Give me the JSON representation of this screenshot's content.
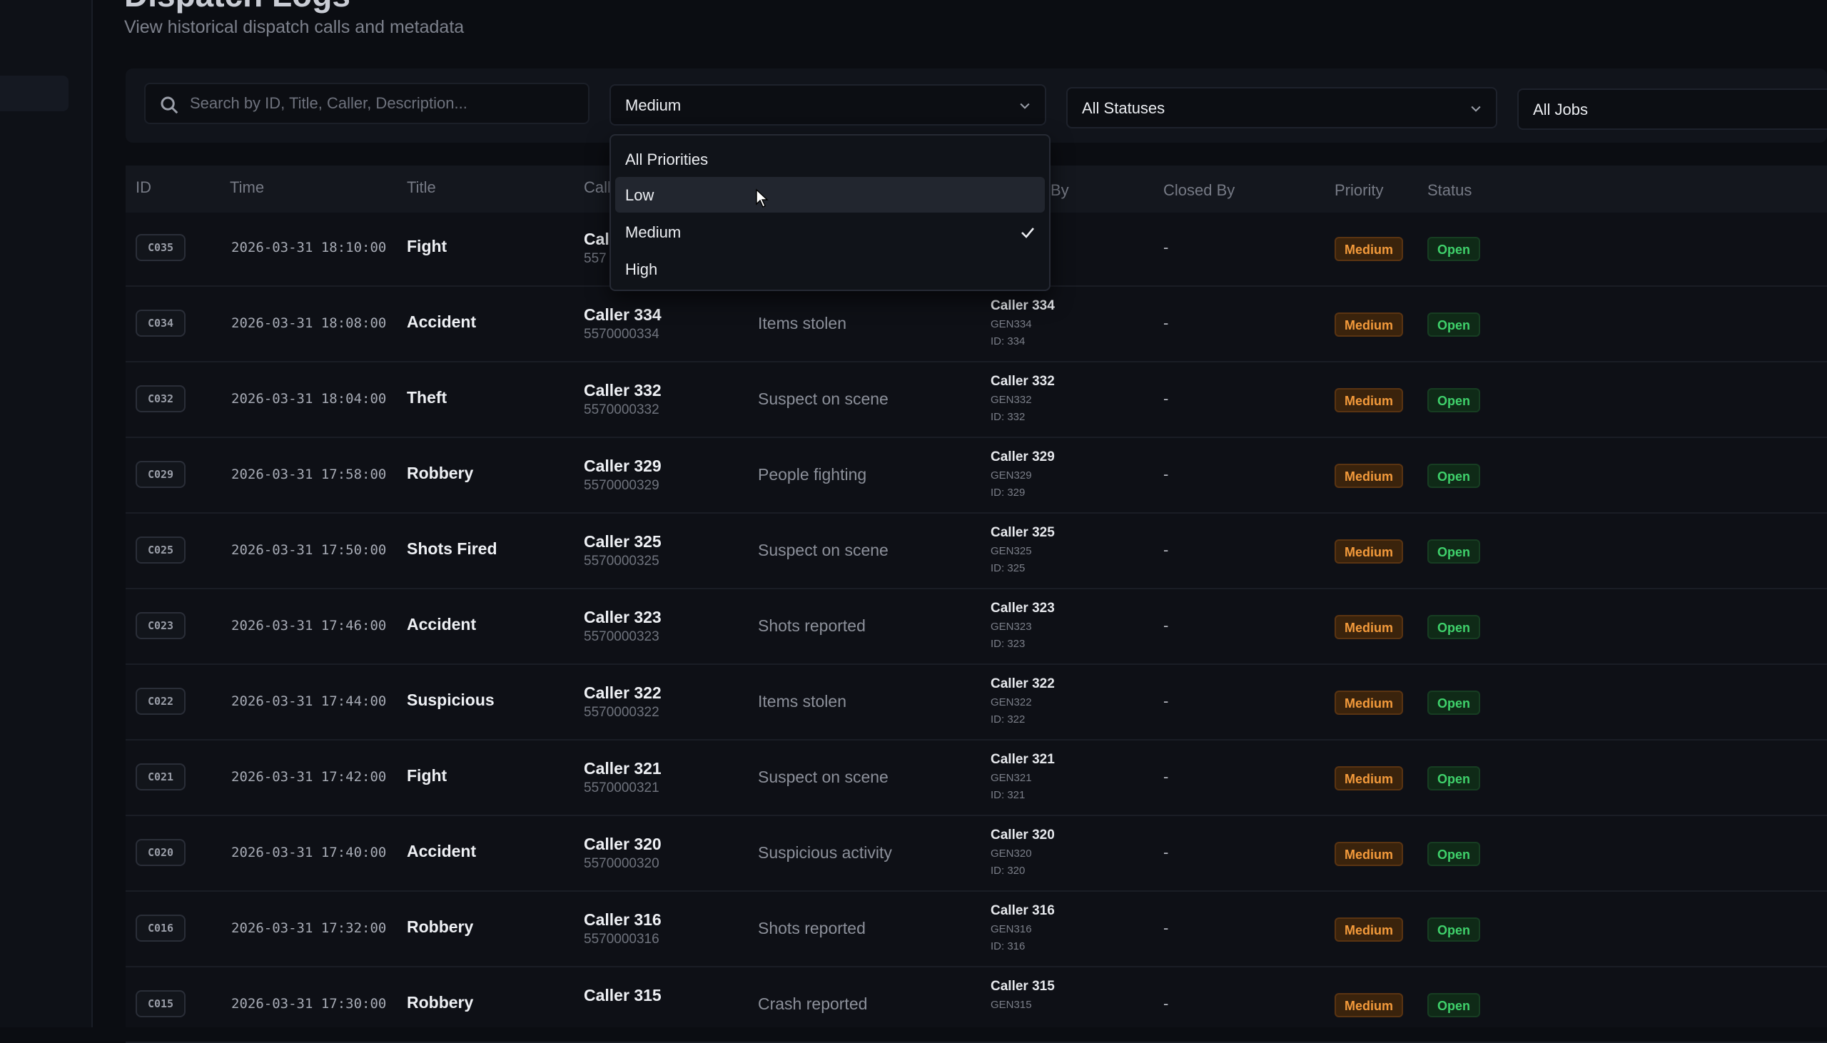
{
  "header": {
    "title": "Dispatch Logs",
    "subtitle": "View historical dispatch calls and metadata"
  },
  "filters": {
    "search_placeholder": "Search by ID, Title, Caller, Description...",
    "priority_value": "Medium",
    "status_value": "All Statuses",
    "jobs_value": "All Jobs"
  },
  "priority_dropdown": {
    "options": [
      "All Priorities",
      "Low",
      "Medium",
      "High"
    ],
    "selected": "Medium",
    "hovered": "Low"
  },
  "table": {
    "columns": {
      "id": "ID",
      "time": "Time",
      "title": "Title",
      "caller": "Call",
      "created_by": "By",
      "closed_by": "Closed By",
      "priority": "Priority",
      "status": "Status"
    },
    "rows": [
      {
        "id": "C035",
        "time": "2026-03-31 18:10:00",
        "title": "Fight",
        "caller": "Call",
        "phone": "557",
        "description": "",
        "cb_name": "",
        "cb_gen": "",
        "cb_id": "",
        "closed_by": "-",
        "priority": "Medium",
        "status": "Open"
      },
      {
        "id": "C034",
        "time": "2026-03-31 18:08:00",
        "title": "Accident",
        "caller": "Caller 334",
        "phone": "5570000334",
        "description": "Items stolen",
        "cb_name": "Caller 334",
        "cb_gen": "GEN334",
        "cb_id": "ID: 334",
        "closed_by": "-",
        "priority": "Medium",
        "status": "Open"
      },
      {
        "id": "C032",
        "time": "2026-03-31 18:04:00",
        "title": "Theft",
        "caller": "Caller 332",
        "phone": "5570000332",
        "description": "Suspect on scene",
        "cb_name": "Caller 332",
        "cb_gen": "GEN332",
        "cb_id": "ID: 332",
        "closed_by": "-",
        "priority": "Medium",
        "status": "Open"
      },
      {
        "id": "C029",
        "time": "2026-03-31 17:58:00",
        "title": "Robbery",
        "caller": "Caller 329",
        "phone": "5570000329",
        "description": "People fighting",
        "cb_name": "Caller 329",
        "cb_gen": "GEN329",
        "cb_id": "ID: 329",
        "closed_by": "-",
        "priority": "Medium",
        "status": "Open"
      },
      {
        "id": "C025",
        "time": "2026-03-31 17:50:00",
        "title": "Shots Fired",
        "caller": "Caller 325",
        "phone": "5570000325",
        "description": "Suspect on scene",
        "cb_name": "Caller 325",
        "cb_gen": "GEN325",
        "cb_id": "ID: 325",
        "closed_by": "-",
        "priority": "Medium",
        "status": "Open"
      },
      {
        "id": "C023",
        "time": "2026-03-31 17:46:00",
        "title": "Accident",
        "caller": "Caller 323",
        "phone": "5570000323",
        "description": "Shots reported",
        "cb_name": "Caller 323",
        "cb_gen": "GEN323",
        "cb_id": "ID: 323",
        "closed_by": "-",
        "priority": "Medium",
        "status": "Open"
      },
      {
        "id": "C022",
        "time": "2026-03-31 17:44:00",
        "title": "Suspicious",
        "caller": "Caller 322",
        "phone": "5570000322",
        "description": "Items stolen",
        "cb_name": "Caller 322",
        "cb_gen": "GEN322",
        "cb_id": "ID: 322",
        "closed_by": "-",
        "priority": "Medium",
        "status": "Open"
      },
      {
        "id": "C021",
        "time": "2026-03-31 17:42:00",
        "title": "Fight",
        "caller": "Caller 321",
        "phone": "5570000321",
        "description": "Suspect on scene",
        "cb_name": "Caller 321",
        "cb_gen": "GEN321",
        "cb_id": "ID: 321",
        "closed_by": "-",
        "priority": "Medium",
        "status": "Open"
      },
      {
        "id": "C020",
        "time": "2026-03-31 17:40:00",
        "title": "Accident",
        "caller": "Caller 320",
        "phone": "5570000320",
        "description": "Suspicious activity",
        "cb_name": "Caller 320",
        "cb_gen": "GEN320",
        "cb_id": "ID: 320",
        "closed_by": "-",
        "priority": "Medium",
        "status": "Open"
      },
      {
        "id": "C016",
        "time": "2026-03-31 17:32:00",
        "title": "Robbery",
        "caller": "Caller 316",
        "phone": "5570000316",
        "description": "Shots reported",
        "cb_name": "Caller 316",
        "cb_gen": "GEN316",
        "cb_id": "ID: 316",
        "closed_by": "-",
        "priority": "Medium",
        "status": "Open"
      },
      {
        "id": "C015",
        "time": "2026-03-31 17:30:00",
        "title": "Robbery",
        "caller": "Caller 315",
        "phone": "",
        "description": "Crash reported",
        "cb_name": "Caller 315",
        "cb_gen": "GEN315",
        "cb_id": "",
        "closed_by": "-",
        "priority": "Medium",
        "status": "Open"
      }
    ]
  },
  "icons": {
    "search": "search-icon",
    "chevron": "chevron-down-icon",
    "check": "check-icon",
    "cursor": "mouse-pointer-icon"
  },
  "colors": {
    "priority_medium": "#f39a3b",
    "status_open": "#3fd16b",
    "background": "#0b0d12"
  }
}
